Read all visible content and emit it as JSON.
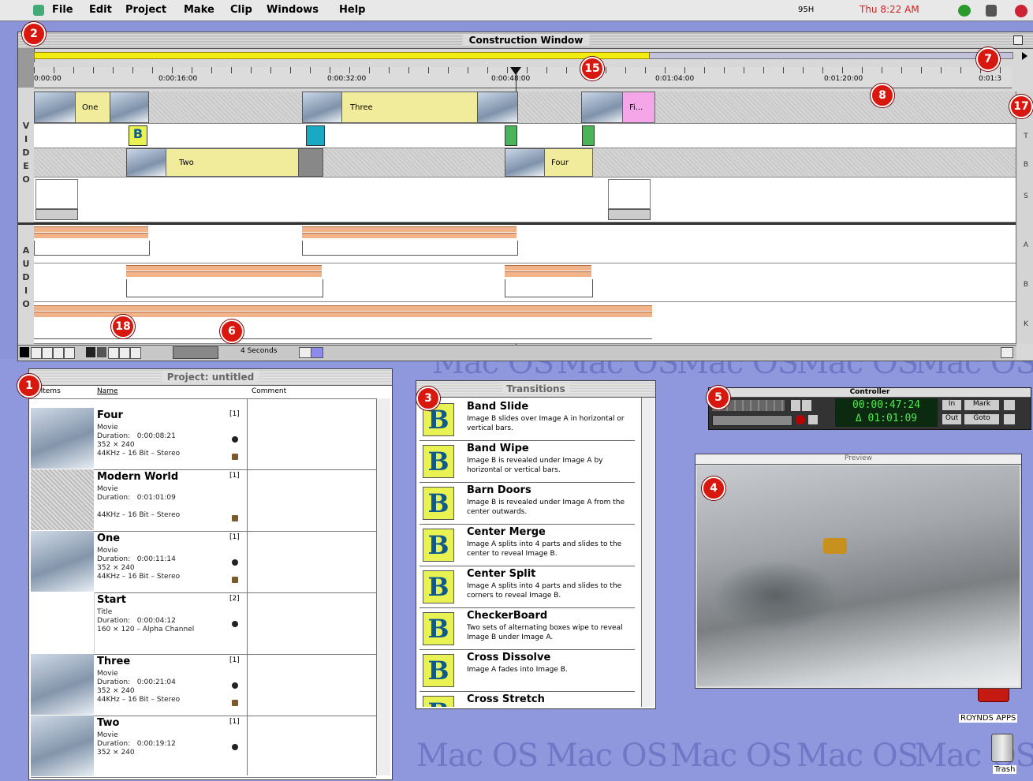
{
  "menubar": {
    "items": [
      "File",
      "Edit",
      "Project",
      "Make",
      "Clip",
      "Windows",
      "Help"
    ],
    "memory": "95H",
    "clock": "Thu 8:22 AM"
  },
  "construction": {
    "title": "Construction Window",
    "ruler_ticks": [
      "0:00:00",
      "0:00:16:00",
      "0:00:32:00",
      "0:00:48:00",
      "0:01:04:00",
      "0:01:20:00",
      "0:01:3"
    ],
    "video_label": [
      "V",
      "I",
      "D",
      "E",
      "O"
    ],
    "audio_label": [
      "A",
      "U",
      "D",
      "I",
      "O"
    ],
    "track_right_labels": [
      "T",
      "B",
      "S",
      "A",
      "B",
      "K"
    ],
    "clips": {
      "one": "One",
      "three": "Three",
      "fi": "Fi...",
      "two": "Two",
      "four": "Four",
      "trans_b": "B"
    },
    "time_unit": "4 Seconds"
  },
  "markers": {
    "m1": "1",
    "m2": "2",
    "m3": "3",
    "m4": "4",
    "m5": "5",
    "m6": "6",
    "m7": "7",
    "m8": "8",
    "m15": "15",
    "m17": "17",
    "m18": "18"
  },
  "project": {
    "title": "Project: untitled",
    "col_items": "6 Items",
    "col_name": "Name",
    "col_comment": "Comment",
    "rows": [
      {
        "name": "Four",
        "count": "[1]",
        "meta": "Movie\nDuration:   0:00:08:21\n352 × 240\n44KHz – 16 Bit – Stereo"
      },
      {
        "name": "Modern World",
        "count": "[1]",
        "meta": "Movie\nDuration:   0:01:01:09\n\n44KHz – 16 Bit – Stereo"
      },
      {
        "name": "One",
        "count": "[1]",
        "meta": "Movie\nDuration:   0:00:11:14\n352 × 240\n44KHz – 16 Bit – Stereo"
      },
      {
        "name": "Start",
        "count": "[2]",
        "meta": "Title\nDuration:   0:00:04:12\n160 × 120 – Alpha Channel"
      },
      {
        "name": "Three",
        "count": "[1]",
        "meta": "Movie\nDuration:   0:00:21:04\n352 × 240\n44KHz – 16 Bit – Stereo"
      },
      {
        "name": "Two",
        "count": "[1]",
        "meta": "Movie\nDuration:   0:00:19:12\n352 × 240"
      }
    ]
  },
  "transitions": {
    "title": "Transitions",
    "items": [
      {
        "name": "Band Slide",
        "desc": "Image B slides over Image A in horizontal or vertical bars.",
        "glyph": "B"
      },
      {
        "name": "Band Wipe",
        "desc": "Image B is revealed under Image A by horizontal or vertical bars.",
        "glyph": "B"
      },
      {
        "name": "Barn Doors",
        "desc": "Image B is revealed under Image A from the center outwards.",
        "glyph": "B"
      },
      {
        "name": "Center Merge",
        "desc": "Image A splits into 4 parts and slides to the center to reveal Image B.",
        "glyph": "B"
      },
      {
        "name": "Center Split",
        "desc": "Image A splits into 4 parts and slides to the corners to reveal Image B.",
        "glyph": "B"
      },
      {
        "name": "CheckerBoard",
        "desc": "Two sets of alternating boxes wipe to reveal Image B under Image A.",
        "glyph": "B"
      },
      {
        "name": "Cross Dissolve",
        "desc": "Image A fades into Image B.",
        "glyph": "B"
      },
      {
        "name": "Cross Stretch",
        "desc": "",
        "glyph": "B"
      }
    ]
  },
  "controller": {
    "title": "Controller",
    "timecode": "00:00:47:24",
    "duration": "Δ 01:01:09",
    "btn_in": "In",
    "btn_mark": "Mark",
    "btn_out": "Out",
    "btn_goto": "Goto"
  },
  "preview": {
    "title": "Preview"
  },
  "desktop": {
    "macos": "Mac OS",
    "app_icon": "ROYNDS APPS",
    "trash": "Trash"
  }
}
